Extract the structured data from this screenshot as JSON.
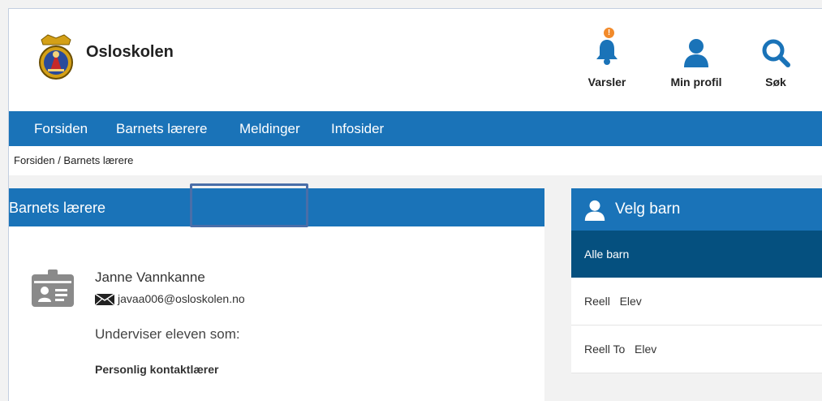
{
  "header": {
    "brand": "Osloskolen",
    "notifications": {
      "label": "Varsler",
      "badge": "!"
    },
    "profile": {
      "label": "Min profil"
    },
    "search": {
      "label": "Søk"
    }
  },
  "nav": {
    "items": [
      "Forsiden",
      "Barnets lærere",
      "Meldinger",
      "Infosider"
    ]
  },
  "breadcrumb": "Forsiden / Barnets lærere",
  "teachers_panel": {
    "title": "Barnets lærere",
    "teacher": {
      "name": "Janne Vannkanne",
      "email": "javaa006@osloskolen.no",
      "teaches_as_label": "Underviser eleven som:",
      "role": "Personlig kontaktlærer"
    }
  },
  "children_panel": {
    "title": "Velg barn",
    "items": [
      "Alle barn",
      "Reell   Elev",
      "Reell To   Elev"
    ],
    "selected_index": 0
  },
  "colors": {
    "primary": "#1a73b8",
    "selected": "#05507f",
    "badge": "#f28a2a",
    "highlight_border": "#4a6ea8"
  },
  "icons": {
    "logo": "oslo-coat-of-arms",
    "notifications": "bell-icon",
    "profile": "user-icon",
    "search": "search-icon",
    "teacher": "id-card-icon",
    "email": "envelope-icon",
    "children_header": "user-icon"
  }
}
